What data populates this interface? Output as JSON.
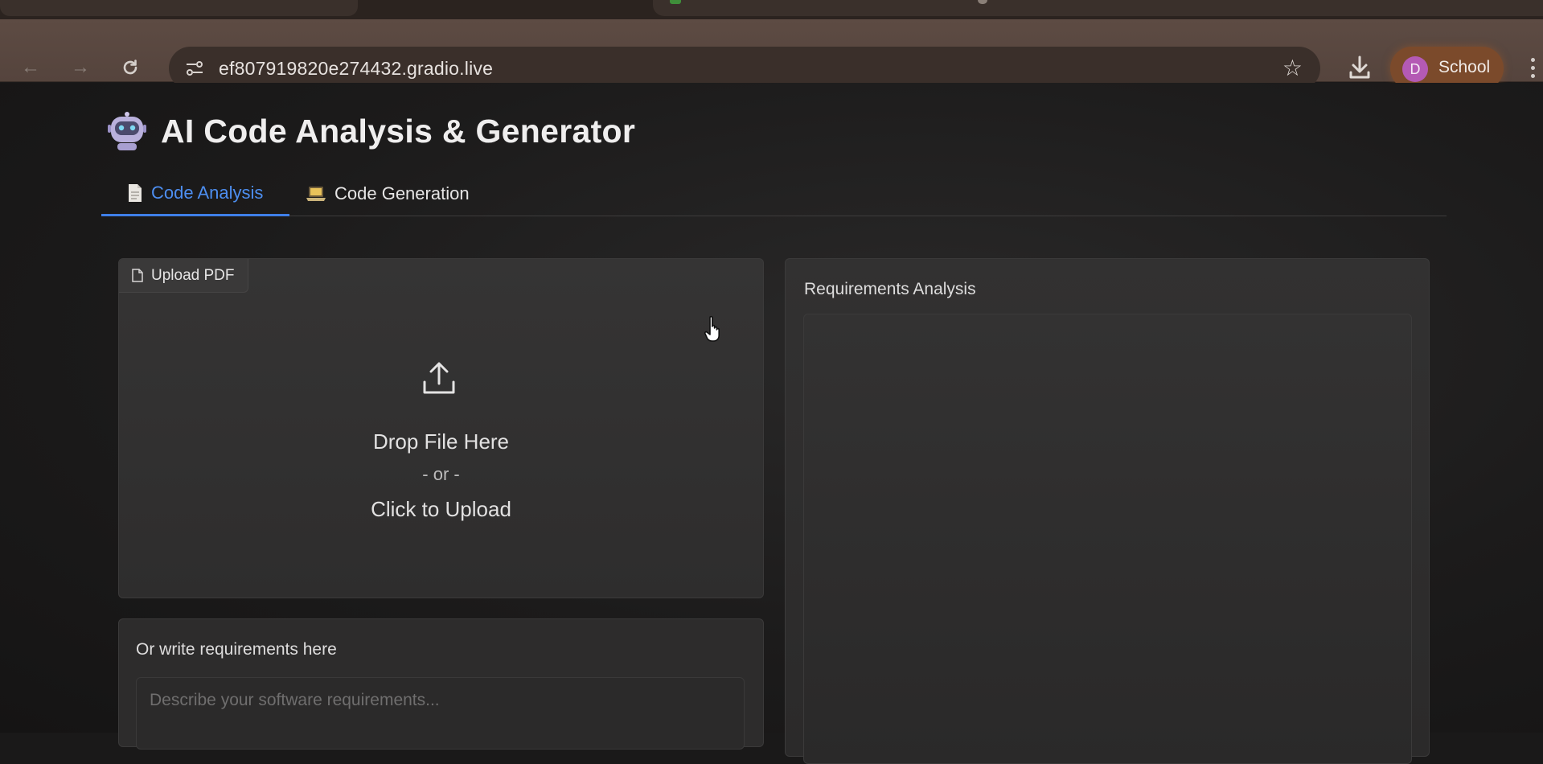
{
  "browser": {
    "url": "ef807919820e274432.gradio.live",
    "profile_initial": "D",
    "profile_name": "School"
  },
  "app": {
    "title": "AI Code Analysis & Generator"
  },
  "tabs": [
    {
      "label": "Code Analysis",
      "active": true
    },
    {
      "label": "Code Generation",
      "active": false
    }
  ],
  "upload": {
    "label": "Upload PDF",
    "drop_text": "Drop File Here",
    "or_text": "- or -",
    "click_text": "Click to Upload"
  },
  "requirements": {
    "label": "Or write requirements here",
    "placeholder": "Describe your software requirements..."
  },
  "analysis": {
    "label": "Requirements Analysis"
  },
  "colors": {
    "accent": "#4d8ef0",
    "background": "#1a1919",
    "panel": "#2f2e2e"
  }
}
